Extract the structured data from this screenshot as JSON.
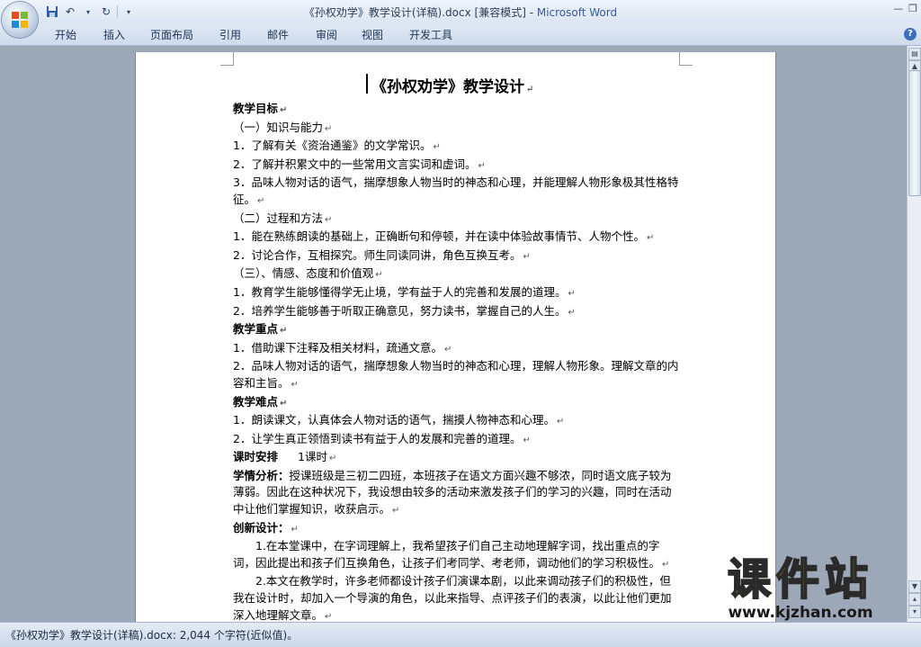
{
  "window": {
    "title_doc": "《孙权劝学》教学设计(详稿).docx [兼容模式] - ",
    "title_app": "Microsoft Word"
  },
  "ribbon": {
    "tabs": [
      "开始",
      "插入",
      "页面布局",
      "引用",
      "邮件",
      "审阅",
      "视图",
      "开发工具"
    ]
  },
  "document": {
    "title": "《孙权劝学》教学设计",
    "lines": [
      {
        "text": "教学目标",
        "style": "h"
      },
      {
        "text": "（一）知识与能力",
        "style": "n"
      },
      {
        "text": "1．了解有关《资治通鉴》的文学常识。",
        "style": "n"
      },
      {
        "text": "2．了解并积累文中的一些常用文言实词和虚词。",
        "style": "n"
      },
      {
        "text": "3．品味人物对话的语气，揣摩想象人物当时的神态和心理，并能理解人物形象极其性格特征。",
        "style": "n"
      },
      {
        "text": "（二）过程和方法",
        "style": "n"
      },
      {
        "text": "1．能在熟练朗读的基础上，正确断句和停顿，并在读中体验故事情节、人物个性。",
        "style": "n"
      },
      {
        "text": "2．讨论合作，互相探究。师生同读同讲，角色互换互考。",
        "style": "n"
      },
      {
        "text": "（三）、情感、态度和价值观",
        "style": "n"
      },
      {
        "text": "1．教育学生能够懂得学无止境，学有益于人的完善和发展的道理。",
        "style": "n"
      },
      {
        "text": "2．培养学生能够善于听取正确意见，努力读书，掌握自己的人生。",
        "style": "n"
      },
      {
        "text": "教学重点",
        "style": "h"
      },
      {
        "text": "1．借助课下注释及相关材料，疏通文意。",
        "style": "n"
      },
      {
        "text": "2．品味人物对话的语气，揣摩想象人物当时的神态和心理，理解人物形象。理解文章的内容和主旨。",
        "style": "n"
      },
      {
        "text": "教学难点",
        "style": "h"
      },
      {
        "text": "1．朗读课文，认真体会人物对话的语气，揣摸人物神态和心理。",
        "style": "n"
      },
      {
        "text": "2．让学生真正领悟到读书有益于人的发展和完善的道理。",
        "style": "n"
      }
    ],
    "schedule_label": "课时安排",
    "schedule_value": "1课时",
    "analysis_label": "学情分析：",
    "analysis_text": "授课班级是三初二四班，本班孩子在语文方面兴趣不够浓，同时语文底子较为薄弱。因此在这种状况下，我设想由较多的活动来激发孩子们的学习的兴趣，同时在活动中让他们掌握知识，收获启示。",
    "innovation_label": "创新设计：",
    "innovation_p1": "1.在本堂课中，在字词理解上，我希望孩子们自己主动地理解字词，找出重点的字词，因此提出和孩子们互换角色，让孩子们考同学、考老师，调动他们的学习积极性。",
    "innovation_p2": "2.本文在教学时，许多老师都设计孩子们演课本剧，以此来调动孩子们的积极性，但我在设计时，却加入一个导演的角色，以此来指导、点评孩子们的表演，以此让他们更加深入地理解文章。"
  },
  "statusbar": {
    "text": "《孙权劝学》教学设计(详稿).docx: 2,044 个字符(近似值)。"
  },
  "watermark": {
    "name": "课件站",
    "url": "www.kjzhan.com"
  },
  "icons": [
    "office-button-icon",
    "save-icon",
    "undo-icon",
    "redo-icon",
    "customize-qat-icon",
    "minimize-icon",
    "restore-icon",
    "help-icon",
    "scroll-up-icon",
    "scroll-down-icon",
    "paragraph-mark-icon"
  ],
  "colors": {
    "title_app": "#3a5a94",
    "watermark_fill": "#f2e409"
  }
}
